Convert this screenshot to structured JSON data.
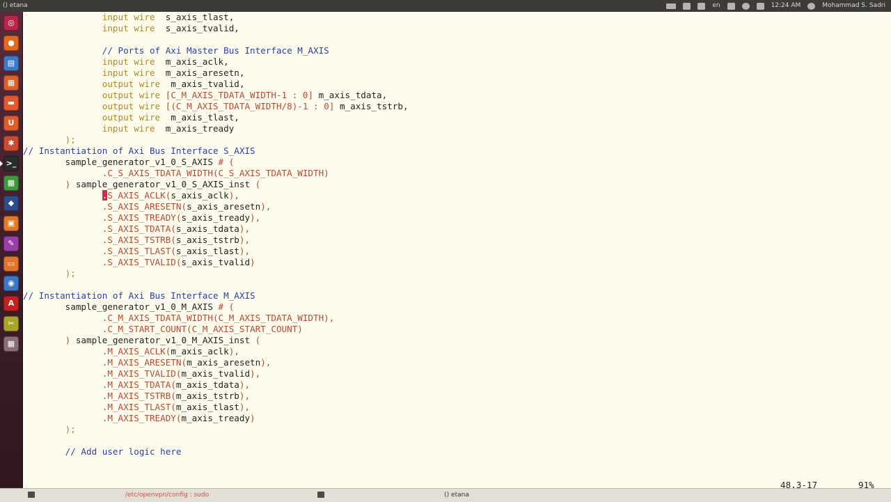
{
  "window": {
    "title": "() etana"
  },
  "topbar": {
    "lang": "en",
    "time": "12:24 AM",
    "user": "Mohammad S. Sadri"
  },
  "launcher": {
    "items": [
      {
        "name": "dash-home-icon",
        "color": "#b9264a",
        "glyph": "◎"
      },
      {
        "name": "firefox-icon",
        "color": "#e36a1c",
        "glyph": "●"
      },
      {
        "name": "libreoffice-writer-icon",
        "color": "#3b7bc6",
        "glyph": "▤"
      },
      {
        "name": "libreoffice-impress-icon",
        "color": "#d9622b",
        "glyph": "▦"
      },
      {
        "name": "files-icon",
        "color": "#e3592d",
        "glyph": "▬"
      },
      {
        "name": "software-center-icon",
        "color": "#e15a27",
        "glyph": "U"
      },
      {
        "name": "settings-icon",
        "color": "#c94b30",
        "glyph": "✱"
      },
      {
        "name": "terminal-icon",
        "color": "#2b2b2b",
        "glyph": ">_"
      },
      {
        "name": "libreoffice-calc-icon",
        "color": "#3c9a3c",
        "glyph": "▦"
      },
      {
        "name": "network-icon",
        "color": "#2d4d8a",
        "glyph": "◆"
      },
      {
        "name": "archive-icon",
        "color": "#e1792a",
        "glyph": "▣"
      },
      {
        "name": "text-editor-icon",
        "color": "#9a3ea8",
        "glyph": "✎"
      },
      {
        "name": "package-icon",
        "color": "#e0732e",
        "glyph": "▭"
      },
      {
        "name": "browser-icon",
        "color": "#3a77c4",
        "glyph": "◉"
      },
      {
        "name": "pdf-reader-icon",
        "color": "#c8201e",
        "glyph": "A"
      },
      {
        "name": "tools-icon",
        "color": "#a7a528",
        "glyph": "✂"
      },
      {
        "name": "workspace-switcher-icon",
        "color": "#8a6f78",
        "glyph": "▦"
      }
    ]
  },
  "editor": {
    "lines": [
      [
        {
          "t": "               "
        },
        {
          "t": "input wire",
          "c": "kw"
        },
        {
          "t": "  s_axis_tlast,"
        }
      ],
      [
        {
          "t": "               "
        },
        {
          "t": "input wire",
          "c": "kw"
        },
        {
          "t": "  s_axis_tvalid,"
        }
      ],
      [
        {
          "t": ""
        }
      ],
      [
        {
          "t": "               "
        },
        {
          "t": "// Ports of Axi Master Bus Interface M_AXIS",
          "c": "cm"
        }
      ],
      [
        {
          "t": "               "
        },
        {
          "t": "input wire",
          "c": "kw"
        },
        {
          "t": "  m_axis_aclk,"
        }
      ],
      [
        {
          "t": "               "
        },
        {
          "t": "input wire",
          "c": "kw"
        },
        {
          "t": "  m_axis_aresetn,"
        }
      ],
      [
        {
          "t": "               "
        },
        {
          "t": "output wire",
          "c": "kw"
        },
        {
          "t": "  m_axis_tvalid,"
        }
      ],
      [
        {
          "t": "               "
        },
        {
          "t": "output wire",
          "c": "kw"
        },
        {
          "t": " "
        },
        {
          "t": "[C_M_AXIS_TDATA_WIDTH-1 : 0]",
          "c": "pm"
        },
        {
          "t": " m_axis_tdata,"
        }
      ],
      [
        {
          "t": "               "
        },
        {
          "t": "output wire",
          "c": "kw"
        },
        {
          "t": " "
        },
        {
          "t": "[(C_M_AXIS_TDATA_WIDTH/8)-1 : 0]",
          "c": "pm"
        },
        {
          "t": " m_axis_tstrb,"
        }
      ],
      [
        {
          "t": "               "
        },
        {
          "t": "output wire",
          "c": "kw"
        },
        {
          "t": "  m_axis_tlast,"
        }
      ],
      [
        {
          "t": "               "
        },
        {
          "t": "input wire",
          "c": "kw"
        },
        {
          "t": "  m_axis_tready"
        }
      ],
      [
        {
          "t": "        "
        },
        {
          "t": ");",
          "c": "kw"
        }
      ],
      [
        {
          "t": "// Instantiation of Axi Bus Interface S_AXIS",
          "c": "cm"
        }
      ],
      [
        {
          "t": "        sample_generator_v1_0_S_AXIS "
        },
        {
          "t": "# (",
          "c": "pm"
        }
      ],
      [
        {
          "t": "               "
        },
        {
          "t": ".C_S_AXIS_TDATA_WIDTH(C_S_AXIS_TDATA_WIDTH)",
          "c": "pm"
        }
      ],
      [
        {
          "t": "        "
        },
        {
          "t": ")",
          "c": "pm"
        },
        {
          "t": " sample_generator_v1_0_S_AXIS_inst "
        },
        {
          "t": "(",
          "c": "pm"
        }
      ],
      [
        {
          "t": "               "
        },
        {
          "t": ".",
          "c": "cursor"
        },
        {
          "t": "S_AXIS_ACLK(",
          "c": "pm"
        },
        {
          "t": "s_axis_aclk"
        },
        {
          "t": "),",
          "c": "pm"
        }
      ],
      [
        {
          "t": "               "
        },
        {
          "t": ".S_AXIS_ARESETN(",
          "c": "pm"
        },
        {
          "t": "s_axis_aresetn"
        },
        {
          "t": "),",
          "c": "pm"
        }
      ],
      [
        {
          "t": "               "
        },
        {
          "t": ".S_AXIS_TREADY(",
          "c": "pm"
        },
        {
          "t": "s_axis_tready"
        },
        {
          "t": "),",
          "c": "pm"
        }
      ],
      [
        {
          "t": "               "
        },
        {
          "t": ".S_AXIS_TDATA(",
          "c": "pm"
        },
        {
          "t": "s_axis_tdata"
        },
        {
          "t": "),",
          "c": "pm"
        }
      ],
      [
        {
          "t": "               "
        },
        {
          "t": ".S_AXIS_TSTRB(",
          "c": "pm"
        },
        {
          "t": "s_axis_tstrb"
        },
        {
          "t": "),",
          "c": "pm"
        }
      ],
      [
        {
          "t": "               "
        },
        {
          "t": ".S_AXIS_TLAST(",
          "c": "pm"
        },
        {
          "t": "s_axis_tlast"
        },
        {
          "t": "),",
          "c": "pm"
        }
      ],
      [
        {
          "t": "               "
        },
        {
          "t": ".S_AXIS_TVALID(",
          "c": "pm"
        },
        {
          "t": "s_axis_tvalid"
        },
        {
          "t": ")",
          "c": "pm"
        }
      ],
      [
        {
          "t": "        "
        },
        {
          "t": ");",
          "c": "kw"
        }
      ],
      [
        {
          "t": ""
        }
      ],
      [
        {
          "t": "// Instantiation of Axi Bus Interface M_AXIS",
          "c": "cm"
        }
      ],
      [
        {
          "t": "        sample_generator_v1_0_M_AXIS "
        },
        {
          "t": "# (",
          "c": "pm"
        }
      ],
      [
        {
          "t": "               "
        },
        {
          "t": ".C_M_AXIS_TDATA_WIDTH(C_M_AXIS_TDATA_WIDTH),",
          "c": "pm"
        }
      ],
      [
        {
          "t": "               "
        },
        {
          "t": ".C_M_START_COUNT(C_M_AXIS_START_COUNT)",
          "c": "pm"
        }
      ],
      [
        {
          "t": "        "
        },
        {
          "t": ")",
          "c": "pm"
        },
        {
          "t": " sample_generator_v1_0_M_AXIS_inst "
        },
        {
          "t": "(",
          "c": "pm"
        }
      ],
      [
        {
          "t": "               "
        },
        {
          "t": ".M_AXIS_ACLK(",
          "c": "pm"
        },
        {
          "t": "m_axis_aclk"
        },
        {
          "t": "),",
          "c": "pm"
        }
      ],
      [
        {
          "t": "               "
        },
        {
          "t": ".M_AXIS_ARESETN(",
          "c": "pm"
        },
        {
          "t": "m_axis_aresetn"
        },
        {
          "t": "),",
          "c": "pm"
        }
      ],
      [
        {
          "t": "               "
        },
        {
          "t": ".M_AXIS_TVALID(",
          "c": "pm"
        },
        {
          "t": "m_axis_tvalid"
        },
        {
          "t": "),",
          "c": "pm"
        }
      ],
      [
        {
          "t": "               "
        },
        {
          "t": ".M_AXIS_TDATA(",
          "c": "pm"
        },
        {
          "t": "m_axis_tdata"
        },
        {
          "t": "),",
          "c": "pm"
        }
      ],
      [
        {
          "t": "               "
        },
        {
          "t": ".M_AXIS_TSTRB(",
          "c": "pm"
        },
        {
          "t": "m_axis_tstrb"
        },
        {
          "t": "),",
          "c": "pm"
        }
      ],
      [
        {
          "t": "               "
        },
        {
          "t": ".M_AXIS_TLAST(",
          "c": "pm"
        },
        {
          "t": "m_axis_tlast"
        },
        {
          "t": "),",
          "c": "pm"
        }
      ],
      [
        {
          "t": "               "
        },
        {
          "t": ".M_AXIS_TREADY(",
          "c": "pm"
        },
        {
          "t": "m_axis_tready"
        },
        {
          "t": ")",
          "c": "pm"
        }
      ],
      [
        {
          "t": "        "
        },
        {
          "t": ");",
          "c": "kw"
        }
      ],
      [
        {
          "t": ""
        }
      ],
      [
        {
          "t": "        "
        },
        {
          "t": "// Add user logic here",
          "c": "cm"
        }
      ]
    ],
    "ruler": {
      "position": "48,3-17",
      "percent": "91%"
    }
  },
  "taskbar": {
    "tasks": [
      {
        "label": "/etc/openvpn/config : sudo",
        "active": false
      },
      {
        "label": "() etana",
        "active": true
      }
    ]
  }
}
